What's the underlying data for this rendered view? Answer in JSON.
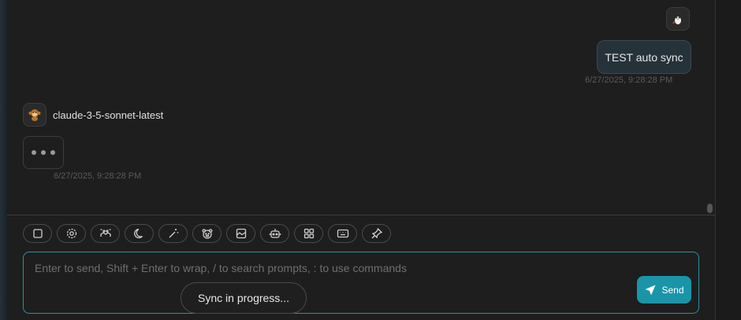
{
  "messages": {
    "user": {
      "avatar_icon": "penguin-avatar-icon",
      "text": "TEST auto sync",
      "timestamp": "6/27/2025, 9:28:28 PM"
    },
    "bot": {
      "avatar_icon": "monkey-avatar-icon",
      "model_name": "claude-3-5-sonnet-latest",
      "status": "typing",
      "timestamp": "6/27/2025, 9:28:28 PM"
    }
  },
  "toolbar": {
    "buttons": [
      {
        "icon": "stop-icon"
      },
      {
        "icon": "settings-icon"
      },
      {
        "icon": "mask-icon"
      },
      {
        "icon": "moon-icon"
      },
      {
        "icon": "magic-wand-icon"
      },
      {
        "icon": "bear-icon"
      },
      {
        "icon": "image-icon"
      },
      {
        "icon": "robot-icon"
      },
      {
        "icon": "grid-icon"
      },
      {
        "icon": "keyboard-icon"
      },
      {
        "icon": "pin-icon"
      }
    ]
  },
  "input": {
    "placeholder": "Enter to send, Shift + Enter to wrap, / to search prompts, : to use commands",
    "value": ""
  },
  "send_button": {
    "label": "Send",
    "icon": "send-arrow-icon"
  },
  "toast": {
    "text": "Sync in progress..."
  },
  "colors": {
    "accent": "#1a95a8",
    "input_border": "#2e8fa3",
    "background": "#1e1e1e"
  }
}
